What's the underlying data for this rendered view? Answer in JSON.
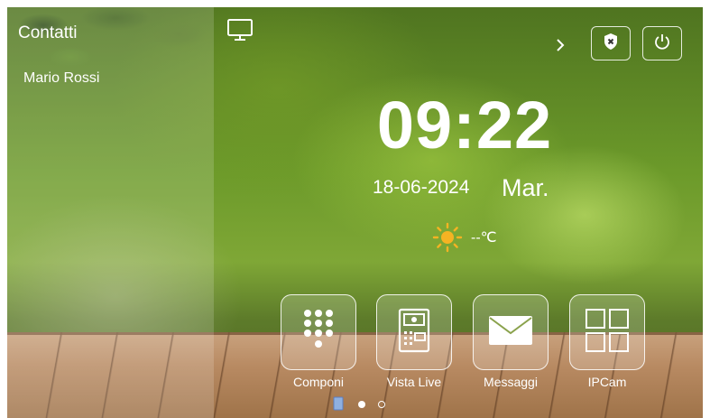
{
  "sidebar": {
    "title": "Contatti",
    "contacts": [
      "Mario Rossi"
    ]
  },
  "header": {
    "monitor_icon": "monitor-icon",
    "next_icon": "chevron-right-icon",
    "shield_icon": "shield-icon",
    "power_icon": "power-icon"
  },
  "clock": {
    "time": "09:22",
    "date": "18-06-2024",
    "weekday": "Mar."
  },
  "weather": {
    "icon": "sun-icon",
    "temperature": "--℃"
  },
  "apps": [
    {
      "label": "Componi",
      "icon": "dialpad-icon"
    },
    {
      "label": "Vista Live",
      "icon": "intercom-panel-icon"
    },
    {
      "label": "Messaggi",
      "icon": "envelope-icon"
    },
    {
      "label": "IPCam",
      "icon": "camera-grid-icon"
    }
  ],
  "pager": {
    "pages": 2,
    "current": 1
  },
  "colors": {
    "text": "#ffffff",
    "sun": "#f5b323"
  }
}
